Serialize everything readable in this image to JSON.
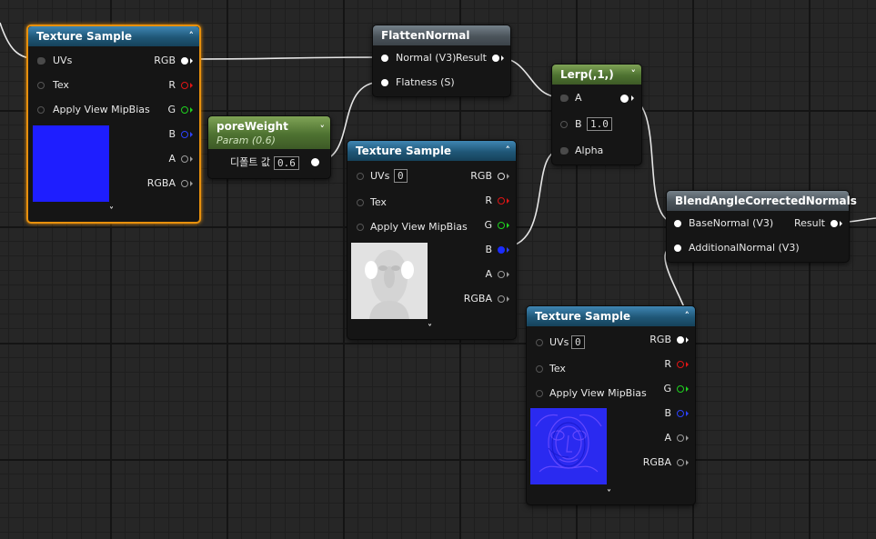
{
  "nodes": {
    "tex1": {
      "title": "Texture Sample",
      "uvs": "UVs",
      "tex": "Tex",
      "mip": "Apply View MipBias",
      "outputs": [
        "RGB",
        "R",
        "G",
        "B",
        "A",
        "RGBA"
      ],
      "preview_color": "#1e1eff"
    },
    "flatten": {
      "title": "FlattenNormal",
      "in_normal": "Normal (V3)",
      "in_flatness": "Flatness (S)",
      "out_result": "Result"
    },
    "param": {
      "title": "poreWeight",
      "subtitle": "Param (0.6)",
      "default_label": "디폴트 값",
      "default_value": "0.6"
    },
    "tex2": {
      "title": "Texture Sample",
      "uvs": "UVs",
      "uvs_value": "0",
      "tex": "Tex",
      "mip": "Apply View MipBias",
      "outputs": [
        "RGB",
        "R",
        "G",
        "B",
        "A",
        "RGBA"
      ]
    },
    "lerp": {
      "title": "Lerp(,1,)",
      "in_a": "A",
      "in_b": "B",
      "b_value": "1.0",
      "in_alpha": "Alpha"
    },
    "blend": {
      "title": "BlendAngleCorrectedNormals",
      "in_base": "BaseNormal (V3)",
      "in_additional": "AdditionalNormal (V3)",
      "out_result": "Result"
    },
    "tex3": {
      "title": "Texture Sample",
      "uvs": "UVs",
      "uvs_value": "0",
      "tex": "Tex",
      "mip": "Apply View MipBias",
      "outputs": [
        "RGB",
        "R",
        "G",
        "B",
        "A",
        "RGBA"
      ]
    }
  },
  "icons": {
    "collapse": "chevron-up-icon",
    "expand": "chevron-down-icon",
    "lerp_menu": "chevron-down-icon",
    "param_menu": "chevron-down-icon"
  },
  "colors": {
    "selection": "#e8900c",
    "pin_r": "#e01515",
    "pin_g": "#1fd11f",
    "pin_b": "#2c42ff"
  }
}
